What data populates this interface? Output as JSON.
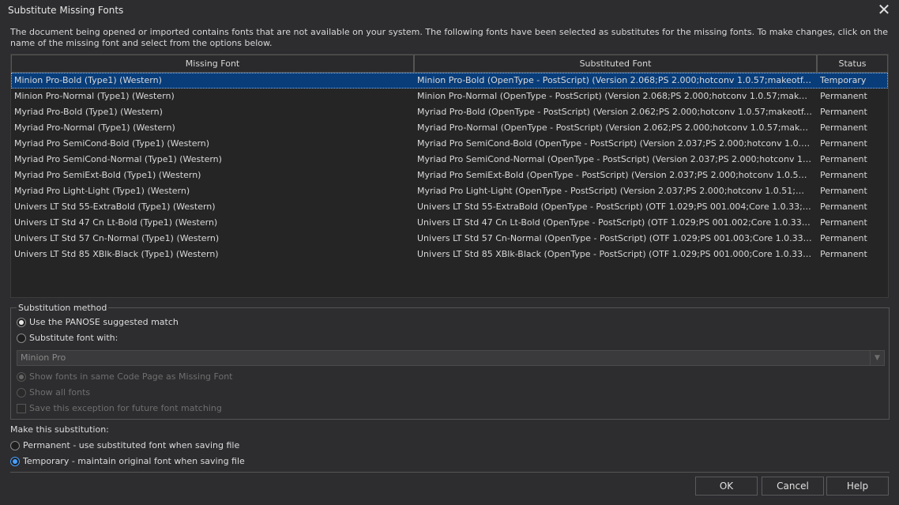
{
  "window": {
    "title": "Substitute Missing Fonts",
    "close_glyph": "✕"
  },
  "intro": "The document being opened or imported contains fonts that are not available on your system.  The following fonts have been selected as substitutes for the missing fonts.  To make changes, click on the name of the missing font and select from the options below.",
  "table": {
    "columns": [
      "Missing Font",
      "Substituted Font",
      "Status"
    ],
    "rows": [
      {
        "missing": "Minion Pro-Bold (Type1) (Western)",
        "substituted": "Minion Pro-Bold (OpenType - PostScript) (Version 2.068;PS 2.000;hotconv 1.0.57;makeotf.lib2....",
        "status": "Temporary",
        "selected": true
      },
      {
        "missing": "Minion Pro-Normal (Type1) (Western)",
        "substituted": "Minion Pro-Normal (OpenType - PostScript) (Version 2.068;PS 2.000;hotconv 1.0.57;makeotf.li...",
        "status": "Permanent"
      },
      {
        "missing": "Myriad Pro-Bold (Type1) (Western)",
        "substituted": "Myriad Pro-Bold (OpenType - PostScript) (Version 2.062;PS 2.000;hotconv 1.0.57;makeotf.lib2....",
        "status": "Permanent"
      },
      {
        "missing": "Myriad Pro-Normal (Type1) (Western)",
        "substituted": "Myriad Pro-Normal (OpenType - PostScript) (Version 2.062;PS 2.000;hotconv 1.0.57;makeotf.li...",
        "status": "Permanent"
      },
      {
        "missing": "Myriad Pro SemiCond-Bold (Type1) (Western)",
        "substituted": "Myriad Pro SemiCond-Bold (OpenType - PostScript) (Version 2.037;PS 2.000;hotconv 1.0.51;m...",
        "status": "Permanent"
      },
      {
        "missing": "Myriad Pro SemiCond-Normal (Type1) (Western)",
        "substituted": "Myriad Pro SemiCond-Normal (OpenType - PostScript) (Version 2.037;PS 2.000;hotconv 1.0.51...",
        "status": "Permanent"
      },
      {
        "missing": "Myriad Pro SemiExt-Bold (Type1) (Western)",
        "substituted": "Myriad Pro SemiExt-Bold (OpenType - PostScript) (Version 2.037;PS 2.000;hotconv 1.0.51;mak...",
        "status": "Permanent"
      },
      {
        "missing": "Myriad Pro Light-Light (Type1) (Western)",
        "substituted": "Myriad Pro Light-Light (OpenType - PostScript) (Version 2.037;PS 2.000;hotconv 1.0.51;makeo...",
        "status": "Permanent"
      },
      {
        "missing": "Univers LT Std 55-ExtraBold (Type1) (Western)",
        "substituted": "Univers LT Std 55-ExtraBold (OpenType - PostScript) (OTF 1.029;PS 001.004;Core 1.0.33;makeo...",
        "status": "Permanent"
      },
      {
        "missing": "Univers LT Std 47 Cn Lt-Bold (Type1) (Western)",
        "substituted": "Univers LT Std 47 Cn Lt-Bold (OpenType - PostScript) (OTF 1.029;PS 001.002;Core 1.0.33;make...",
        "status": "Permanent"
      },
      {
        "missing": "Univers LT Std 57 Cn-Normal (Type1) (Western)",
        "substituted": "Univers LT Std 57 Cn-Normal (OpenType - PostScript) (OTF 1.029;PS 001.003;Core 1.0.33;make...",
        "status": "Permanent"
      },
      {
        "missing": "Univers LT Std 85 XBlk-Black (Type1) (Western)",
        "substituted": "Univers LT Std 85 XBlk-Black (OpenType - PostScript) (OTF 1.029;PS 001.000;Core 1.0.33;make...",
        "status": "Permanent"
      }
    ]
  },
  "substitution_method": {
    "legend": "Substitution method",
    "panose_label": "Use the PANOSE suggested match",
    "panose_selected": true,
    "substitute_with_label": "Substitute font with:",
    "font_combo_value": "Minion Pro",
    "same_code_page_label": "Show fonts in same Code Page as Missing Font",
    "all_fonts_label": "Show all fonts",
    "save_exception_label": "Save this exception for future font matching"
  },
  "make_substitution": {
    "label": "Make this substitution:",
    "permanent_label": "Permanent - use substituted font when saving file",
    "temporary_label": "Temporary - maintain original font when saving file",
    "selected": "temporary"
  },
  "buttons": {
    "ok": "OK",
    "cancel": "Cancel",
    "help": "Help"
  },
  "colors": {
    "background": "#2d2d30",
    "selection": "#083d7a",
    "accent": "#4aa0ff"
  }
}
